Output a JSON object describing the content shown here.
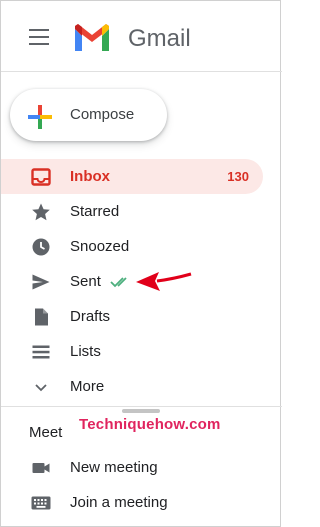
{
  "header": {
    "brand": "Gmail"
  },
  "compose": {
    "label": "Compose"
  },
  "nav": {
    "items": [
      {
        "label": "Inbox",
        "count": "130",
        "active": true
      },
      {
        "label": "Starred"
      },
      {
        "label": "Snoozed"
      },
      {
        "label": "Sent"
      },
      {
        "label": "Drafts"
      },
      {
        "label": "Lists"
      },
      {
        "label": "More"
      }
    ]
  },
  "meet": {
    "title": "Meet",
    "items": [
      {
        "label": "New meeting"
      },
      {
        "label": "Join a meeting"
      }
    ]
  },
  "watermark": {
    "text": "Techniquehow.com"
  },
  "colors": {
    "accent": "#d93025",
    "active_bg": "#fce8e6",
    "watermark": "#e0245e"
  }
}
